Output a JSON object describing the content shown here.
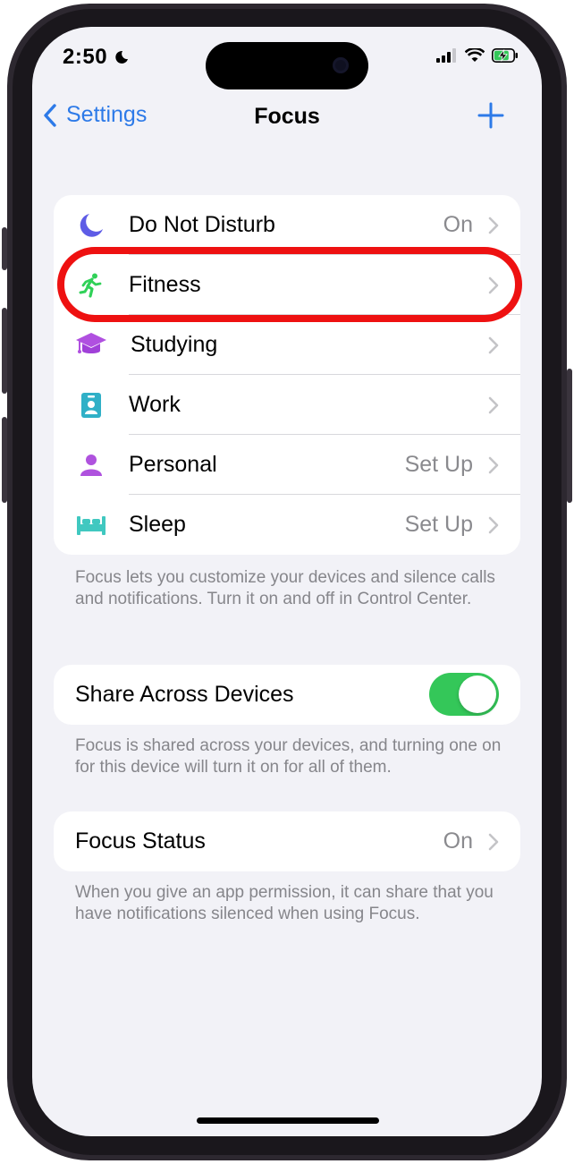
{
  "status_bar": {
    "time": "2:50"
  },
  "nav": {
    "back_label": "Settings",
    "title": "Focus"
  },
  "focus_modes": [
    {
      "label": "Do Not Disturb",
      "value": "On",
      "icon": "moon-icon",
      "color": "#5e5ce6"
    },
    {
      "label": "Fitness",
      "value": "",
      "icon": "running-figure-icon",
      "color": "#30d158"
    },
    {
      "label": "Studying",
      "value": "",
      "icon": "graduation-cap-icon",
      "color": "#b050e0"
    },
    {
      "label": "Work",
      "value": "",
      "icon": "id-badge-icon",
      "color": "#30b0c7"
    },
    {
      "label": "Personal",
      "value": "Set Up",
      "icon": "person-icon",
      "color": "#af52de"
    },
    {
      "label": "Sleep",
      "value": "Set Up",
      "icon": "bed-icon",
      "color": "#40c8c0"
    }
  ],
  "focus_footnote": "Focus lets you customize your devices and silence calls and notifications. Turn it on and off in Control Center.",
  "share": {
    "label": "Share Across Devices",
    "enabled": true,
    "footnote": "Focus is shared across your devices, and turning one on for this device will turn it on for all of them."
  },
  "status": {
    "label": "Focus Status",
    "value": "On",
    "footnote": "When you give an app permission, it can share that you have notifications silenced when using Focus."
  },
  "colors": {
    "accent": "#2d7ae8",
    "toggle_on": "#34c759",
    "highlight": "#ee1111"
  }
}
